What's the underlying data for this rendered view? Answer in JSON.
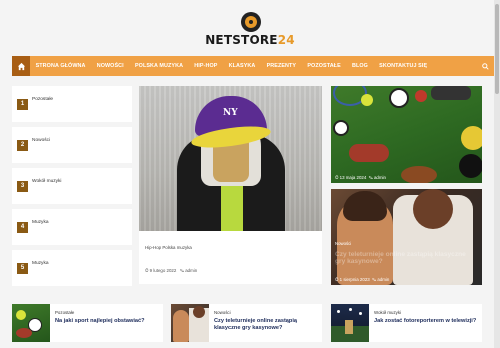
{
  "brand": {
    "name_main": "NETSTORE",
    "name_accent": "24",
    "accent": "#e79a2a",
    "nav_color": "#f0a145",
    "nav_home_color": "#a85e14"
  },
  "nav": {
    "home_icon": "home-icon",
    "search_icon": "search-icon",
    "items": [
      "Strona główna",
      "Nowości",
      "Polska muzyka",
      "Hip-Hop",
      "Klasyka",
      "Prezenty",
      "Pozostałe",
      "Blog",
      "Skontaktuj się"
    ]
  },
  "side_list": [
    {
      "num": "1",
      "label": "Pozostałe"
    },
    {
      "num": "2",
      "label": "Nowości"
    },
    {
      "num": "3",
      "label": "Wokół muzyki"
    },
    {
      "num": "4",
      "label": "Muzyka"
    },
    {
      "num": "5",
      "label": "Muzyka"
    }
  ],
  "feature": {
    "categories": "Hip-Hop  Polska muzyka",
    "date": "9 lutego 2022",
    "author": "admin"
  },
  "right": {
    "one": {
      "date": "13 maja 2024",
      "author": "admin"
    },
    "two": {
      "badge": "Nowości",
      "title": "Czy teleturnieje online zastąpią klasyczne gry kasynowe?",
      "date": "1 sierpnia 2023",
      "author": "admin"
    }
  },
  "bottom": [
    {
      "category": "Pozostałe",
      "title": "Na jaki sport najlepiej obstawiać?"
    },
    {
      "category": "Nowości",
      "title": "Czy teleturnieje online zastąpią klasyczne gry kasynowe?"
    },
    {
      "category": "Wokół muzyki",
      "title": "Jak zostać fotoreporterem w telewizji?"
    }
  ]
}
